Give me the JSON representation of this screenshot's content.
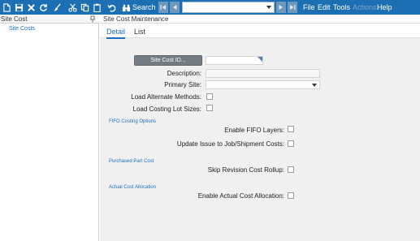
{
  "colors": {
    "toolbar": "#1c6fb3",
    "accent": "#1a6fbd",
    "panel_bg": "#f0f0f0",
    "button": "#747b82"
  },
  "toolbar": {
    "icons": [
      "new-icon",
      "save-icon",
      "delete-icon",
      "refresh-icon",
      "clear-icon",
      "cut-icon",
      "copy-icon",
      "paste-icon",
      "undo-icon",
      "binoculars-icon"
    ],
    "search_label": "Search",
    "nav_value": "",
    "menu": {
      "file": "File",
      "edit": "Edit",
      "tools": "Tools",
      "actions": "Actions",
      "help": "Help"
    }
  },
  "left_panel": {
    "title": "Site Cost",
    "tree_item": "Site Costs"
  },
  "right_panel": {
    "title": "Site Cost Maintenance",
    "tabs": {
      "detail": "Detail",
      "list": "List"
    },
    "site_cost_id_button": "Site Cost ID...",
    "site_cost_id_value": "",
    "description_label": "Description:",
    "description_value": "",
    "primary_site_label": "Primary Site:",
    "primary_site_value": "",
    "load_alternate_methods_label": "Load Alternate Methods:",
    "load_alternate_methods_checked": false,
    "load_costing_lot_sizes_label": "Load Costing Lot Sizes:",
    "load_costing_lot_sizes_checked": false,
    "fifo_section": "FIFO Costing Options",
    "enable_fifo_label": "Enable FIFO Layers:",
    "enable_fifo_checked": false,
    "update_issue_label": "Update Issue to Job/Shipment Costs:",
    "update_issue_checked": false,
    "purchased_section": "Purchased Part Cost",
    "skip_revision_label": "Skip Revision Cost Rollup:",
    "skip_revision_checked": false,
    "actual_cost_section": "Actual Cost Allocation",
    "enable_actual_label": "Enable Actual Cost Allocation:",
    "enable_actual_checked": false
  }
}
